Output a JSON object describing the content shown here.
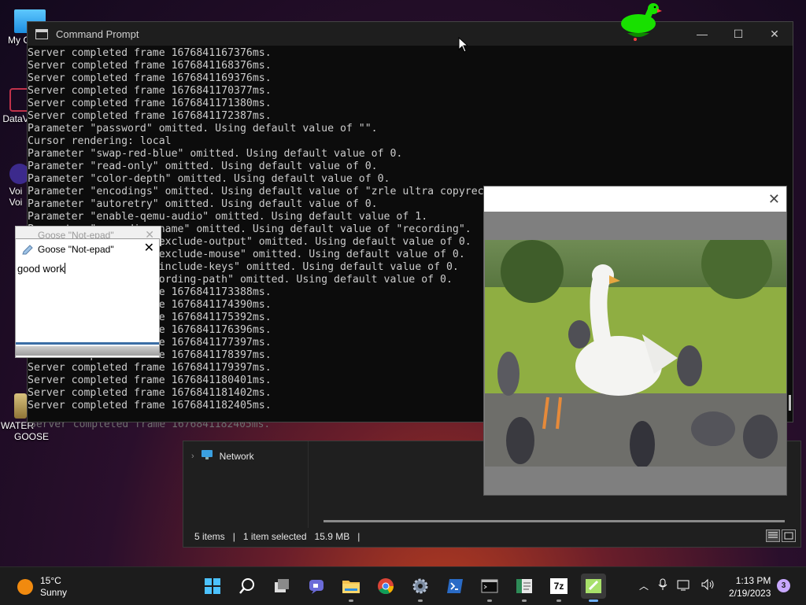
{
  "desktop": {
    "icons": [
      {
        "label": "My C"
      },
      {
        "label": "DataV"
      },
      {
        "label": "Voi"
      },
      {
        "label": "Voi"
      },
      {
        "label": "WATER"
      },
      {
        "label": "GOOSE"
      }
    ]
  },
  "explorer": {
    "nav_item": "Network",
    "status_items": "5 items",
    "status_selected": "1 item selected",
    "status_size": "15.9 MB"
  },
  "ghost_console_line": "Server completed frame 1676841182405ms.",
  "cmd": {
    "title": "Command Prompt",
    "lines": [
      "Server completed frame 1676841167376ms.",
      "Server completed frame 1676841168376ms.",
      "Server completed frame 1676841169376ms.",
      "Server completed frame 1676841170377ms.",
      "Server completed frame 1676841171380ms.",
      "Server completed frame 1676841172387ms.",
      "Parameter \"password\" omitted. Using default value of \"\".",
      "Cursor rendering: local",
      "Parameter \"swap-red-blue\" omitted. Using default value of 0.",
      "Parameter \"read-only\" omitted. Using default value of 0.",
      "Parameter \"color-depth\" omitted. Using default value of 0.",
      "Parameter \"encodings\" omitted. Using default value of \"zrle ultra copyrect hextile zlib corre rre raw\".",
      "Parameter \"autoretry\" omitted. Using default value of 0.",
      "Parameter \"enable-qemu-audio\" omitted. Using default value of 1.",
      "Parameter \"recording-name\" omitted. Using default value of \"recording\".",
      "Parameter \"recording-exclude-output\" omitted. Using default value of 0.",
      "Parameter \"recording-exclude-mouse\" omitted. Using default value of 0.",
      "Parameter \"recording-include-keys\" omitted. Using default value of 0.",
      "Parameter \"create-recording-path\" omitted. Using default value of 0.",
      "Server completed frame 1676841173388ms.",
      "Server completed frame 1676841174390ms.",
      "Server completed frame 1676841175392ms.",
      "Server completed frame 1676841176396ms.",
      "Server completed frame 1676841177397ms.",
      "Server completed frame 1676841178397ms.",
      "Server completed frame 1676841179397ms.",
      "Server completed frame 1676841180401ms.",
      "Server completed frame 1676841181402ms.",
      "Server completed frame 1676841182405ms."
    ]
  },
  "notepad": {
    "back_title": "Goose \"Not-epad\"",
    "title": "Goose \"Not-epad\"",
    "text": "good work"
  },
  "taskbar": {
    "weather": {
      "temp": "15°C",
      "condition": "Sunny"
    },
    "apps": [
      {
        "icon": "windows-start-icon"
      },
      {
        "icon": "search-icon"
      },
      {
        "icon": "task-view-icon"
      },
      {
        "icon": "chat-icon"
      },
      {
        "icon": "file-explorer-icon"
      },
      {
        "icon": "chrome-icon"
      },
      {
        "icon": "settings-icon"
      },
      {
        "icon": "powershell-icon"
      },
      {
        "icon": "command-prompt-icon"
      },
      {
        "icon": "document-viewer-icon"
      },
      {
        "icon": "7zip-icon",
        "text": "7z"
      },
      {
        "icon": "notepad-plus-icon"
      }
    ],
    "clock": {
      "time": "1:13 PM",
      "date": "2/19/2023"
    },
    "notifications": "3"
  },
  "colors": {
    "console_bg": "#0c0c0c",
    "console_text": "#cccccc",
    "goose_green": "#18e000",
    "taskbar_bg": "#1c1c1c",
    "active_indicator": "#6fb1ff"
  }
}
